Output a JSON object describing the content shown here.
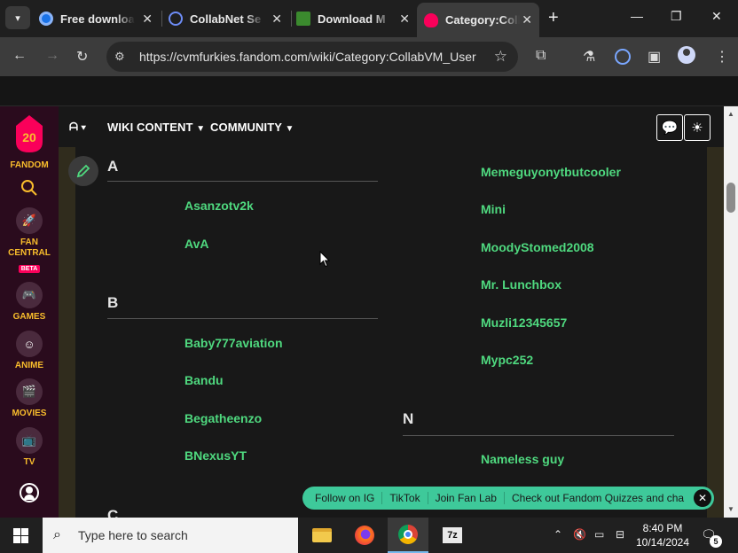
{
  "browser": {
    "tabs": [
      {
        "label": "Free download",
        "icon": "free-download-favicon",
        "active": false
      },
      {
        "label": "CollabNet Se",
        "icon": "search-favicon",
        "active": false
      },
      {
        "label": "Download M",
        "icon": "minecraft-favicon",
        "active": false
      },
      {
        "label": "Category:Coll",
        "icon": "fandom-favicon",
        "active": true
      }
    ],
    "url": "https://cvmfurkies.fandom.com/wiki/Category:CollabVM_User"
  },
  "fandom_rail": {
    "logo_number": "20",
    "logo_text": "FANDOM",
    "items": [
      {
        "label_line1": "FAN",
        "label_line2": "CENTRAL",
        "badge": "BETA",
        "icon": "rocket-icon"
      },
      {
        "label_line1": "GAMES",
        "icon": "controller-icon"
      },
      {
        "label_line1": "ANIME",
        "icon": "anime-face-icon"
      },
      {
        "label_line1": "MOVIES",
        "icon": "clapperboard-icon"
      },
      {
        "label_line1": "TV",
        "icon": "tv-icon"
      }
    ]
  },
  "wiki_nav": {
    "home_icon": "fandom-home-icon",
    "wiki_content": "WIKI CONTENT",
    "community": "COMMUNITY"
  },
  "category": {
    "left": [
      {
        "letter": "A",
        "users": [
          "Asanzotv2k",
          "AvA"
        ]
      },
      {
        "letter": "B",
        "users": [
          "Baby777aviation",
          "Bandu",
          "Begatheenzo",
          "BNexusYT"
        ]
      },
      {
        "letter": "C",
        "users": []
      }
    ],
    "right_top_users": [
      "Memeguyonytbutcooler",
      "Mini",
      "MoodyStomed2008",
      "Mr. Lunchbox",
      "Muzli12345657",
      "Mypc252"
    ],
    "right_sections": [
      {
        "letter": "N",
        "users": [
          "Nameless guy"
        ]
      }
    ]
  },
  "fan_feed": {
    "items": [
      "Follow on IG",
      "TikTok",
      "Join Fan Lab",
      "Check out Fandom Quizzes and cha"
    ]
  },
  "taskbar": {
    "search_placeholder": "Type here to search",
    "time": "8:40 PM",
    "date": "10/14/2024",
    "notification_count": "5",
    "apps": [
      "file-explorer-icon",
      "firefox-icon",
      "chrome-icon",
      "7zip-icon"
    ]
  },
  "colors": {
    "username_green": "#4fd97f",
    "fandom_rail": "#2a0b1d",
    "fandom_yellow": "#f9bd2c",
    "fan_feed_bar": "#3ec99a"
  }
}
